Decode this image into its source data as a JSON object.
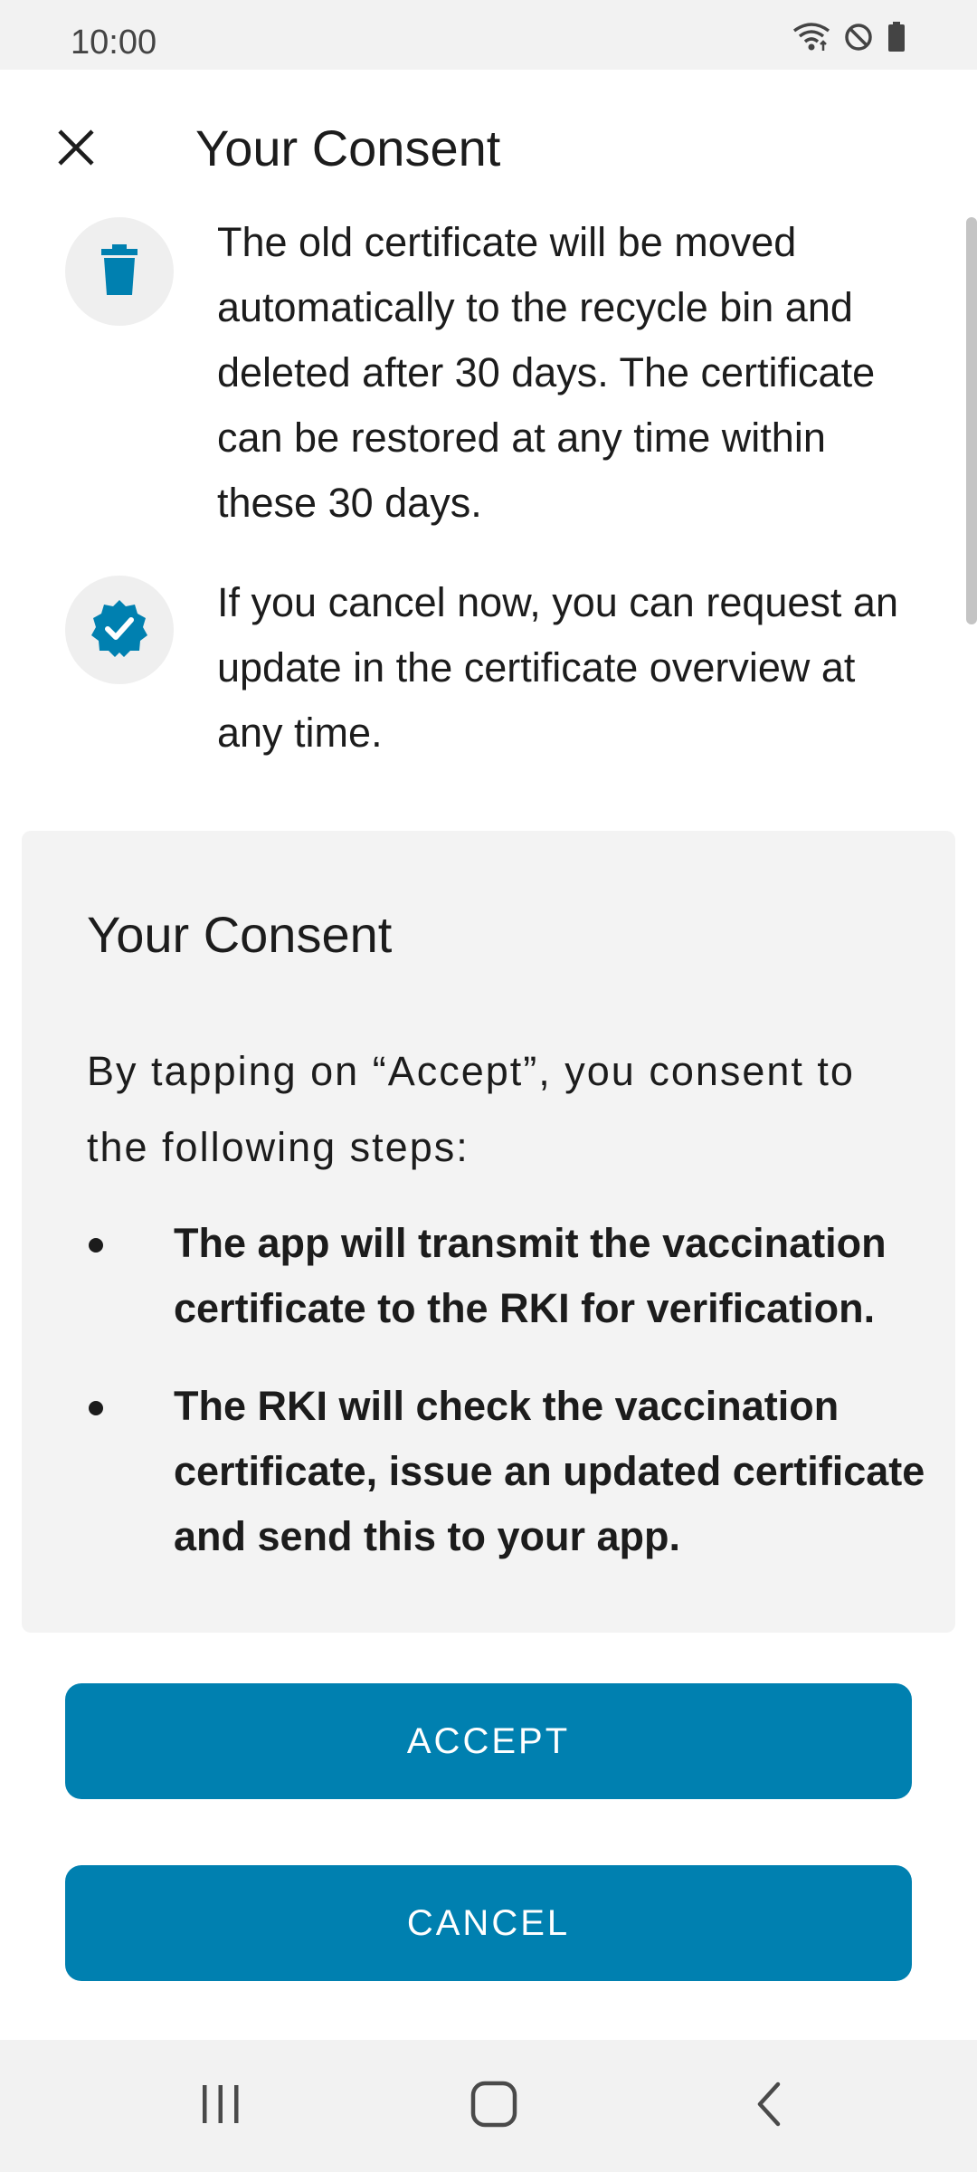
{
  "status_bar": {
    "time": "10:00",
    "icons": [
      "wifi-icon",
      "do-not-disturb-icon",
      "battery-icon"
    ]
  },
  "app_bar": {
    "close_icon": "close-icon",
    "title": "Your Consent"
  },
  "info_items": [
    {
      "icon": "trash-icon",
      "text": "The old certificate will be moved automatically to the recycle bin and deleted after 30 days. The certificate can be restored at any time within these 30 days."
    },
    {
      "icon": "verified-badge-icon",
      "text": "If you cancel now, you can request an update in the certificate overview at any time."
    }
  ],
  "consent": {
    "title": "Your Consent",
    "intro": "By tapping on “Accept”, you consent to the following steps:",
    "bullets": [
      "The app will transmit the vaccination certificate to the RKI for verification.",
      "The RKI will check the vaccination certificate, issue an updated certificate and send this to your app."
    ]
  },
  "buttons": {
    "accept": "ACCEPT",
    "cancel": "CANCEL"
  },
  "nav_bar": {
    "icons": [
      "recent-apps-icon",
      "home-icon",
      "back-icon"
    ]
  },
  "colors": {
    "accent": "#0080b0",
    "box_background": "#f3f3f3",
    "icon_circle": "#efefef"
  }
}
